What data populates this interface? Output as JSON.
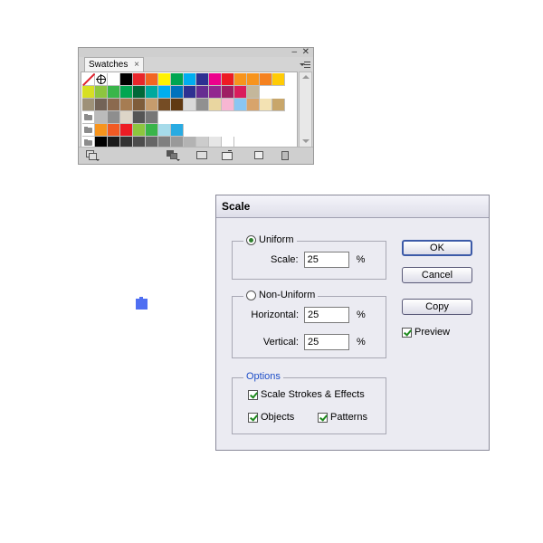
{
  "swatches_panel": {
    "tab_label": "Swatches",
    "tab_close": "×",
    "collapse_glyph": "–",
    "close_glyph": "✕",
    "rows": [
      [
        "none",
        "registration",
        "#ffffff",
        "#000000",
        "#e8262b",
        "#f26522",
        "#fff200",
        "#00a651",
        "#00aeef",
        "#2e3192",
        "#ec008c",
        "#ed1c24",
        "#f7941d",
        "#f7941d",
        "#f58220",
        "#ffcb05"
      ],
      [
        "#d7df23",
        "#8dc63f",
        "#39b54a",
        "#00a651",
        "#006838",
        "#00a99d",
        "#00aeef",
        "#0072bc",
        "#2e3192",
        "#662d91",
        "#92278f",
        "#9e1f63",
        "#da1c5c",
        "#c4b79b"
      ],
      [
        "#9e9178",
        "#736357",
        "#8b6a4f",
        "#a67c52",
        "#7f5d3b",
        "#c69c6d",
        "#754c24",
        "#603913",
        "#d9d9d9",
        "#909090",
        "#e9d6a0",
        "#f7b6d2",
        "#89c6f2",
        "#d8a46b",
        "#f3e2b3",
        "#c8a66a"
      ],
      [
        "#bbbbbb",
        "#8e8e8e",
        "#ddd5c8",
        "#555555",
        "#777777"
      ],
      [
        "#f7941d",
        "#f15a24",
        "#ed1c24",
        "#8dc63f",
        "#39b54a",
        "#a6dbea",
        "#29abe2"
      ],
      [
        "#000000",
        "#1a1a1a",
        "#333333",
        "#4d4d4d",
        "#666666",
        "#808080",
        "#999999",
        "#b3b3b3",
        "#cccccc",
        "#e6e6e6",
        "#ffffff"
      ]
    ]
  },
  "scale_dialog": {
    "title": "Scale",
    "uniform_label": "Uniform",
    "scale_label": "Scale:",
    "scale_value": "25",
    "non_uniform_label": "Non-Uniform",
    "horizontal_label": "Horizontal:",
    "horizontal_value": "25",
    "vertical_label": "Vertical:",
    "vertical_value": "25",
    "percent": "%",
    "options_label": "Options",
    "scale_strokes_label": "Scale Strokes & Effects",
    "objects_label": "Objects",
    "patterns_label": "Patterns",
    "ok_label": "OK",
    "cancel_label": "Cancel",
    "copy_label": "Copy",
    "preview_label": "Preview",
    "uniform_selected": true,
    "preview_checked": true,
    "accent_color": "#2f7f2f",
    "options_color": "#1f4fc8"
  },
  "canvas": {
    "blue_icon_color": "#4f6ff2"
  }
}
